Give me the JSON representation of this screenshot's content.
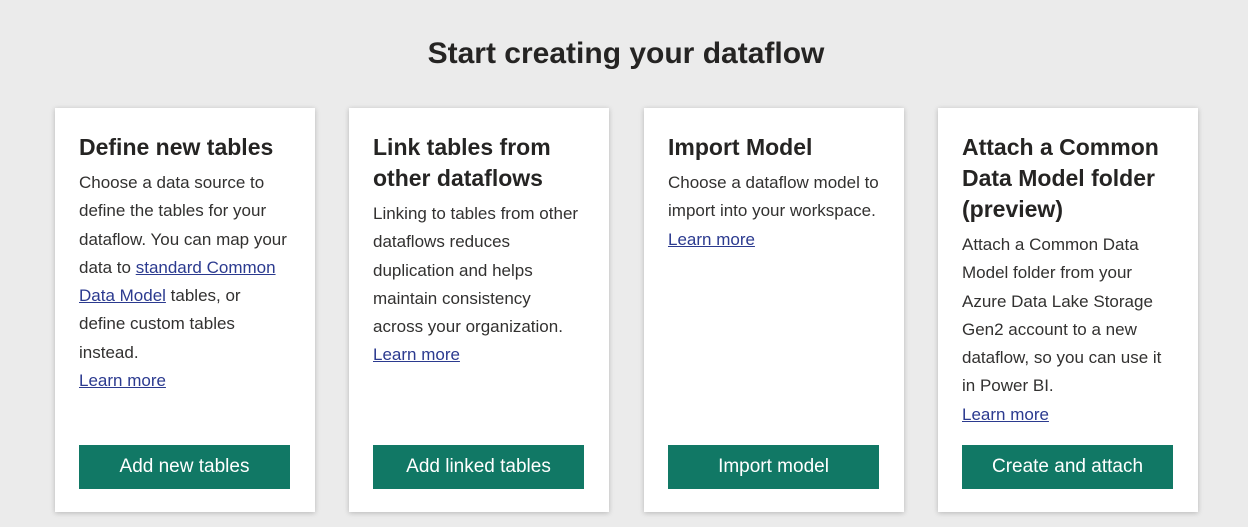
{
  "page": {
    "title": "Start creating your dataflow"
  },
  "cards": [
    {
      "title": "Define new tables",
      "text_before_link": "Choose a data source to define the tables for your dataflow. You can map your data to ",
      "inline_link": "standard Common Data Model",
      "text_after_link": " tables, or define custom tables instead.",
      "learn_more": "Learn more",
      "button": "Add new tables"
    },
    {
      "title": "Link tables from other dataflows",
      "text": "Linking to tables from other dataflows reduces duplication and helps maintain consistency across your organization.",
      "learn_more": "Learn more",
      "button": "Add linked tables"
    },
    {
      "title": "Import Model",
      "text": "Choose a dataflow model to import into your workspace.",
      "learn_more": "Learn more",
      "button": "Import model"
    },
    {
      "title": "Attach a Common Data Model folder (preview)",
      "text": "Attach a Common Data Model folder from your Azure Data Lake Storage Gen2 account to a new dataflow, so you can use it in Power BI.",
      "learn_more": "Learn more",
      "button": "Create and attach"
    }
  ],
  "colors": {
    "background": "#ebebeb",
    "card": "#ffffff",
    "button": "#117865",
    "link": "#2b3a8f"
  }
}
